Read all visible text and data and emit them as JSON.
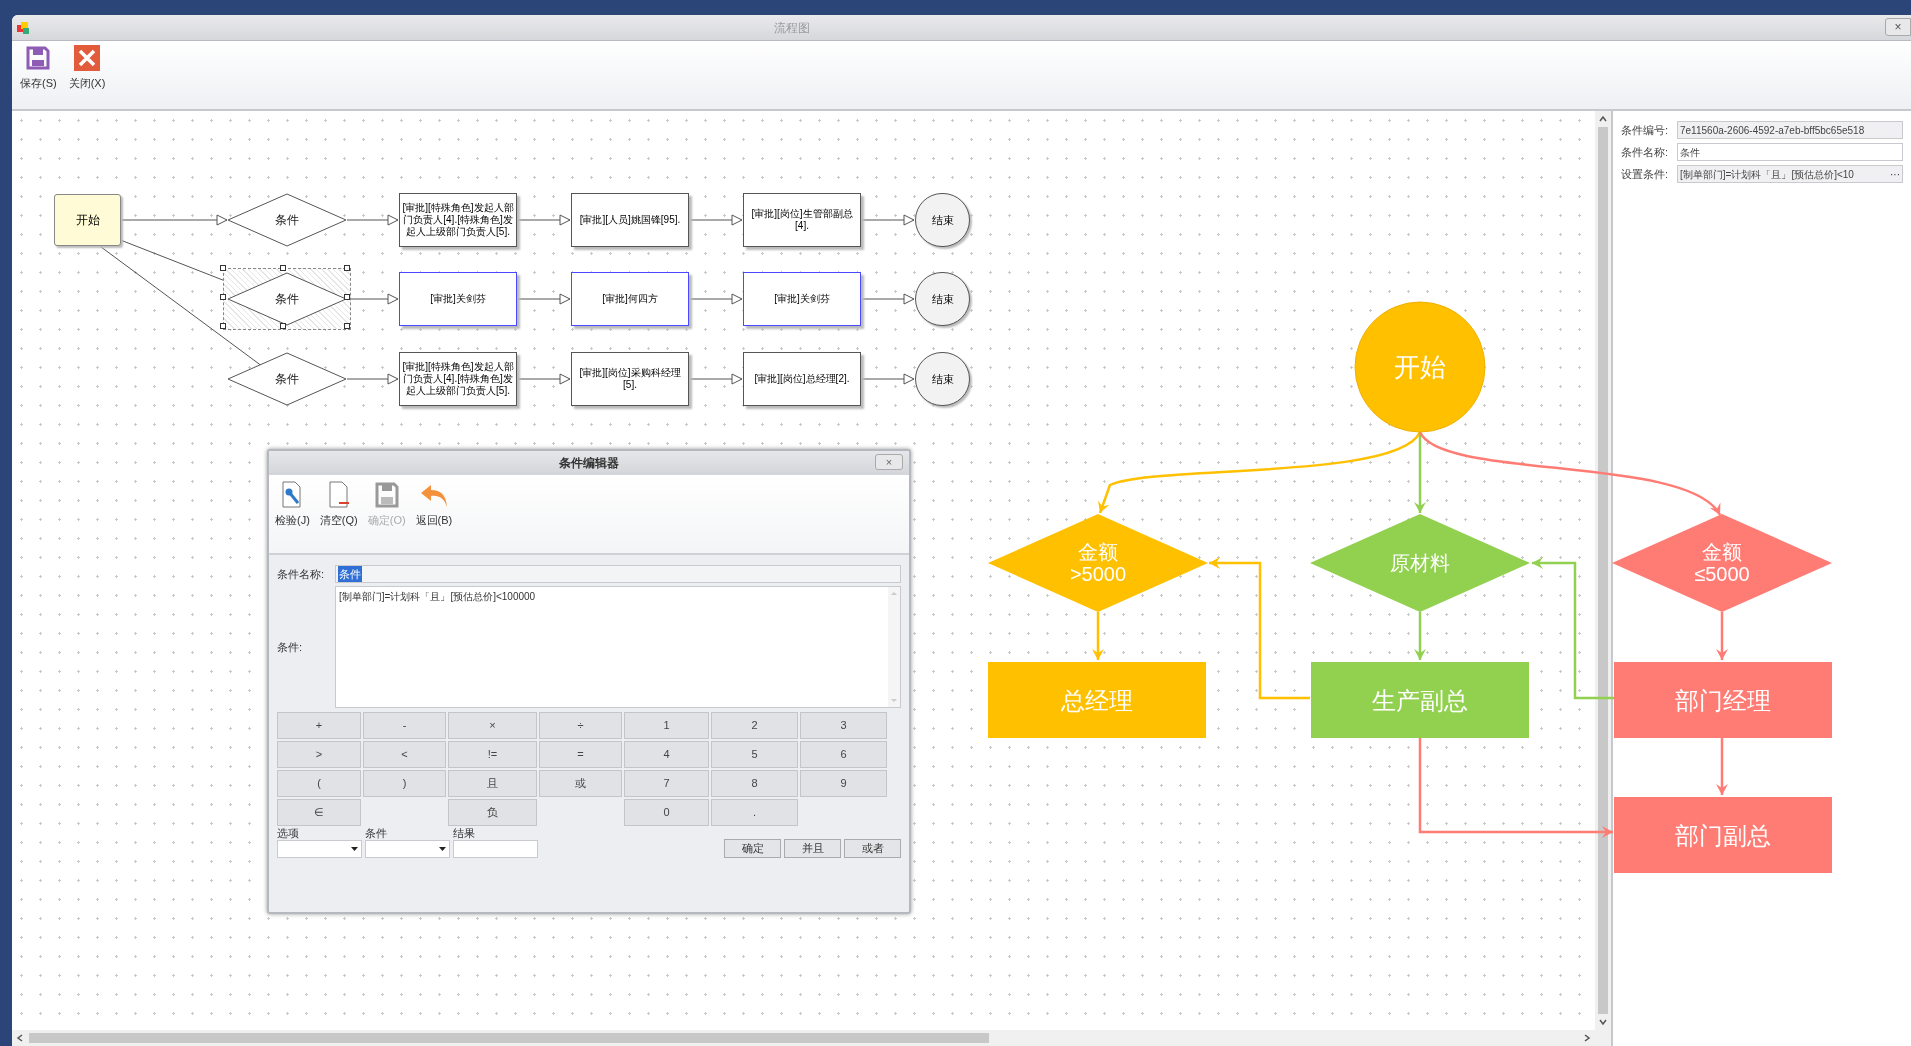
{
  "window": {
    "title": "流程图",
    "close": "×"
  },
  "toolbar": [
    {
      "label": "保存(S)"
    },
    {
      "label": "关闭(X)"
    }
  ],
  "left_flow": {
    "start": {
      "label": "开始"
    },
    "rows": [
      {
        "condition": {
          "label": "条件",
          "selected": false
        },
        "tasks": [
          {
            "label": "[审批][特殊角色]发起人部门负责人[4].[特殊角色]发起人上级部门负责人[5].",
            "highlighted": false
          },
          {
            "label": "[审批][人员]姚国锋[95].",
            "highlighted": false
          },
          {
            "label": "[审批][岗位]生管部副总[4].",
            "highlighted": false
          }
        ],
        "end": {
          "label": "结束"
        }
      },
      {
        "condition": {
          "label": "条件",
          "selected": true
        },
        "tasks": [
          {
            "label": "[审批]关剑芬",
            "highlighted": true
          },
          {
            "label": "[审批]何四方",
            "highlighted": true
          },
          {
            "label": "[审批]关剑芬",
            "highlighted": true
          }
        ],
        "end": {
          "label": "结束"
        }
      },
      {
        "condition": {
          "label": "条件",
          "selected": false
        },
        "tasks": [
          {
            "label": "[审批][特殊角色]发起人部门负责人[4].[特殊角色]发起人上级部门负责人[5].",
            "highlighted": false
          },
          {
            "label": "[审批][岗位]采购科经理[5].",
            "highlighted": false
          },
          {
            "label": "[审批][岗位]总经理[2].",
            "highlighted": false
          }
        ],
        "end": {
          "label": "结束"
        }
      }
    ]
  },
  "dialog": {
    "title": "条件编辑器",
    "close": "×",
    "toolbar": [
      {
        "label": "检验(J)",
        "disabled": false
      },
      {
        "label": "清空(Q)",
        "disabled": false
      },
      {
        "label": "确定(O)",
        "disabled": true
      },
      {
        "label": "返回(B)",
        "disabled": false
      }
    ],
    "name_label": "条件名称:",
    "name_value": "条件",
    "name_value_selected": true,
    "condition_label": "条件:",
    "condition_value": "[制单部门]=计划科「且」[预估总价]<100000",
    "keypad": [
      [
        "+",
        "-",
        "×",
        "÷",
        "1",
        "2",
        "3"
      ],
      [
        ">",
        "<",
        "!=",
        "=",
        "4",
        "5",
        "6"
      ],
      [
        "(",
        ")",
        "且",
        "或",
        "7",
        "8",
        "9"
      ],
      [
        "∈",
        "负",
        "0",
        "."
      ]
    ],
    "selectors": [
      {
        "label": "选项",
        "kind": "dropdown"
      },
      {
        "label": "条件",
        "kind": "dropdown"
      },
      {
        "label": "结果",
        "kind": "text"
      }
    ],
    "buttons": [
      "确定",
      "并且",
      "或者"
    ]
  },
  "properties": [
    {
      "label": "条件编号:",
      "value": "7e11560a-2606-4592-a7eb-bff5bc65e518",
      "readonly": true
    },
    {
      "label": "条件名称:",
      "value": "条件",
      "readonly": false
    },
    {
      "label": "设置条件:",
      "value": "[制单部门]=计划科「且」[预估总价]<10",
      "readonly": true,
      "button": "···"
    }
  ],
  "color_flow": [
    {
      "kind": "circle",
      "lines": [
        "开始"
      ],
      "color": "#ffc000"
    },
    {
      "kind": "diamond",
      "lines": [
        "金额",
        ">5000"
      ],
      "color": "#ffc000"
    },
    {
      "kind": "diamond",
      "lines": [
        "原材料"
      ],
      "color": "#92d050"
    },
    {
      "kind": "diamond",
      "lines": [
        "金额",
        "≤5000"
      ],
      "color": "#ff7c75"
    },
    {
      "kind": "rect",
      "lines": [
        "总经理"
      ],
      "color": "#ffc000"
    },
    {
      "kind": "rect",
      "lines": [
        "生产副总"
      ],
      "color": "#92d050"
    },
    {
      "kind": "rect",
      "lines": [
        "部门经理"
      ],
      "color": "#ff7c75"
    },
    {
      "kind": "rect",
      "lines": [
        "部门副总"
      ],
      "color": "#ff7c75"
    }
  ]
}
